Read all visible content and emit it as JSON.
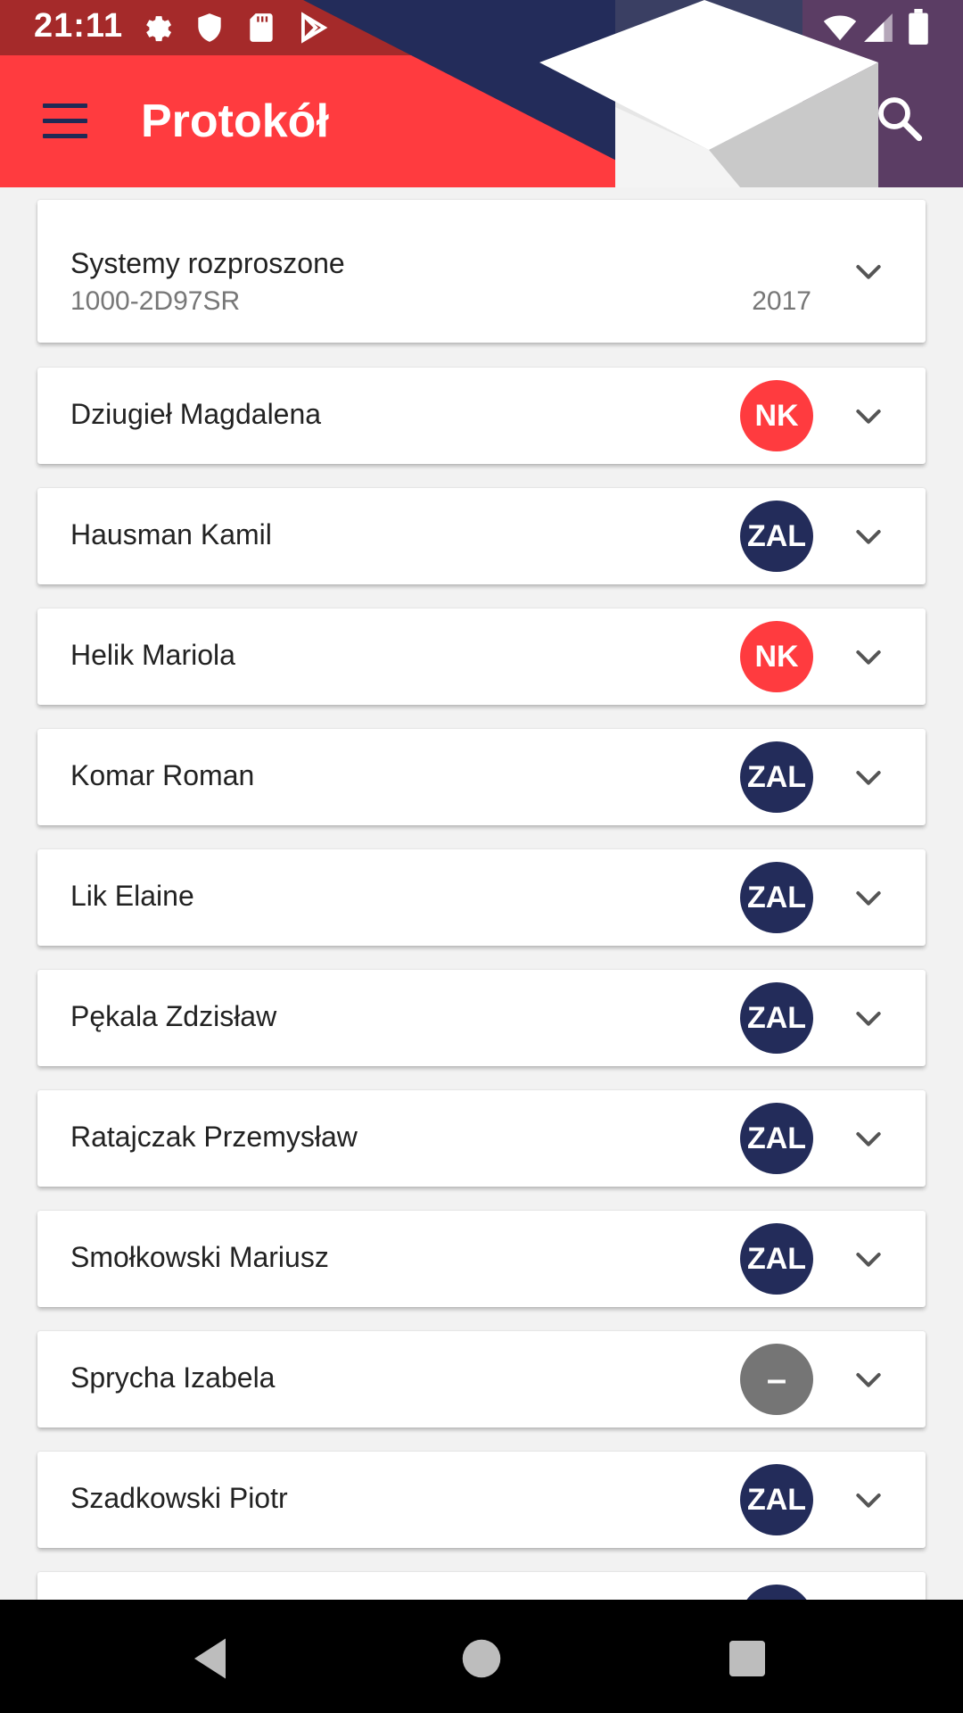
{
  "status_bar": {
    "time": "21:11",
    "icons": [
      "gear-icon",
      "shield-icon",
      "sd-card-icon",
      "play-store-icon",
      "wifi-icon",
      "signal-icon",
      "battery-icon"
    ]
  },
  "toolbar": {
    "title": "Protokół",
    "menu_icon": "menu-icon",
    "search_icon": "search-icon"
  },
  "course": {
    "name": "Systemy rozproszone",
    "code": "1000-2D97SR",
    "year": "2017"
  },
  "students": [
    {
      "name": "Dziugieł Magdalena",
      "grade": "NK",
      "status": "nk"
    },
    {
      "name": "Hausman Kamil",
      "grade": "ZAL",
      "status": "zal"
    },
    {
      "name": "Helik Mariola",
      "grade": "NK",
      "status": "nk"
    },
    {
      "name": "Komar Roman",
      "grade": "ZAL",
      "status": "zal"
    },
    {
      "name": "Lik Elaine",
      "grade": "ZAL",
      "status": "zal"
    },
    {
      "name": "Pękala Zdzisław",
      "grade": "ZAL",
      "status": "zal"
    },
    {
      "name": "Ratajczak Przemysław",
      "grade": "ZAL",
      "status": "zal"
    },
    {
      "name": "Smołkowski Mariusz",
      "grade": "ZAL",
      "status": "zal"
    },
    {
      "name": "Sprycha Izabela",
      "grade": "–",
      "status": "none"
    },
    {
      "name": "Szadkowski Piotr",
      "grade": "ZAL",
      "status": "zal"
    },
    {
      "name": "",
      "grade": "",
      "status": "zal"
    }
  ],
  "colors": {
    "header_red": "#ff3b3f",
    "navy": "#232c5a",
    "badge_nk": "#ff3b3f",
    "badge_zal": "#232c5a",
    "badge_none": "#757575"
  },
  "nav_bar": {
    "icons": [
      "back-icon",
      "home-icon",
      "recents-icon"
    ]
  }
}
